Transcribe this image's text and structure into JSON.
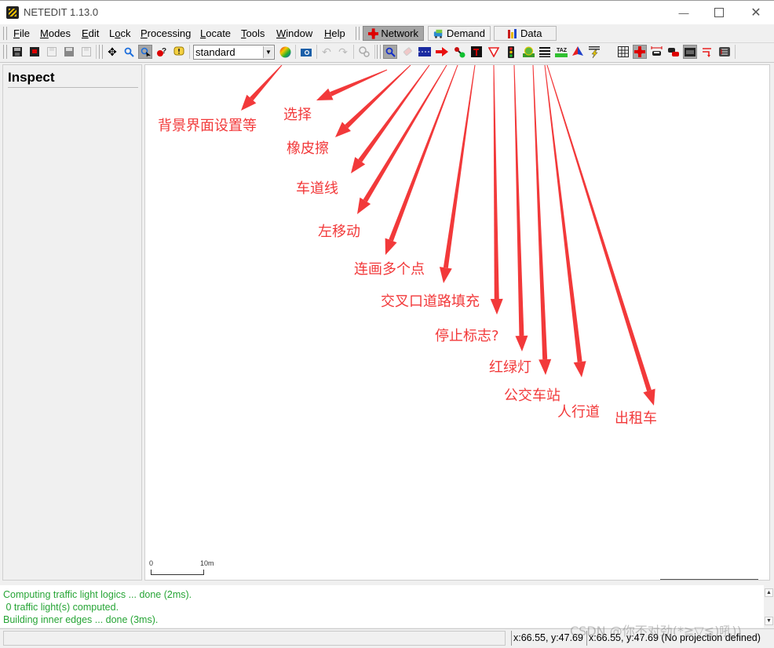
{
  "window": {
    "title": "NETEDIT 1.13.0",
    "controls": {
      "minimize": "—",
      "maximize": "☐",
      "close": "✕"
    }
  },
  "menubar": {
    "items": [
      {
        "label": "File",
        "accel": "F"
      },
      {
        "label": "Modes",
        "accel": "M"
      },
      {
        "label": "Edit",
        "accel": "E"
      },
      {
        "label": "Lock",
        "accel": "o"
      },
      {
        "label": "Processing",
        "accel": "P"
      },
      {
        "label": "Locate",
        "accel": "L"
      },
      {
        "label": "Tools",
        "accel": "T"
      },
      {
        "label": "Window",
        "accel": "W"
      },
      {
        "label": "Help",
        "accel": "H"
      }
    ],
    "supermodes": [
      {
        "label": "Network",
        "icon": "network-icon",
        "active": true
      },
      {
        "label": "Demand",
        "icon": "demand-icon",
        "active": false
      },
      {
        "label": "Data",
        "icon": "data-icon",
        "active": false
      }
    ]
  },
  "toolbar": {
    "file_buttons": [
      "save-network",
      "save-all",
      "save-additionals",
      "save-demand",
      "save-data"
    ],
    "navigation_buttons": [
      "inspect-view",
      "locate",
      "select-mode-view",
      "help-mode",
      "message-mode"
    ],
    "scheme_select": {
      "value": "standard"
    },
    "edit_modes": [
      {
        "name": "inspect",
        "active": true
      },
      {
        "name": "delete"
      },
      {
        "name": "select"
      },
      {
        "name": "move"
      },
      {
        "name": "create-edge"
      },
      {
        "name": "connection"
      },
      {
        "name": "prohibition"
      },
      {
        "name": "traffic-light"
      },
      {
        "name": "additional"
      },
      {
        "name": "crossing"
      },
      {
        "name": "taz"
      },
      {
        "name": "polygon"
      },
      {
        "name": "wire"
      }
    ],
    "view_options": [
      {
        "name": "grid"
      },
      {
        "name": "junction-shape",
        "active": true
      },
      {
        "name": "vehicle-bounds"
      },
      {
        "name": "vehicle-spread"
      },
      {
        "name": "spread-lanes",
        "active": true
      },
      {
        "name": "auto-connections"
      },
      {
        "name": "merge-elements"
      }
    ]
  },
  "sidebar": {
    "title": "Inspect"
  },
  "canvas": {
    "scale_bar": {
      "start": "0",
      "end": "10m"
    },
    "annotations": [
      {
        "text": "背景界面设置等",
        "target": "scheme-select"
      },
      {
        "text": "选择",
        "target": "inspect"
      },
      {
        "text": "橡皮擦",
        "target": "delete"
      },
      {
        "text": "车道线",
        "target": "select"
      },
      {
        "text": "左移动",
        "target": "move"
      },
      {
        "text": "连画多个点",
        "target": "create-edge"
      },
      {
        "text": "交叉口道路填充",
        "target": "connection"
      },
      {
        "text": "停止标志?",
        "target": "prohibition"
      },
      {
        "text": "红绿灯",
        "target": "traffic-light"
      },
      {
        "text": "公交车站",
        "target": "additional"
      },
      {
        "text": "人行道",
        "target": "crossing"
      },
      {
        "text": "出租车",
        "target": "taz"
      }
    ],
    "annotation_color": "#f2393a"
  },
  "log": {
    "lines": [
      "Computing traffic light logics ... done (2ms).",
      " 0 traffic light(s) computed.",
      "Building inner edges ... done (3ms)."
    ],
    "color": "#27a536"
  },
  "statusbar": {
    "coords_geo": "x:66.55, y:47.69",
    "coords_net": "x:66.55, y:47.69 (No projection defined)"
  },
  "watermark": "CSDN @你不对劲(*≧▽≦)吼))"
}
